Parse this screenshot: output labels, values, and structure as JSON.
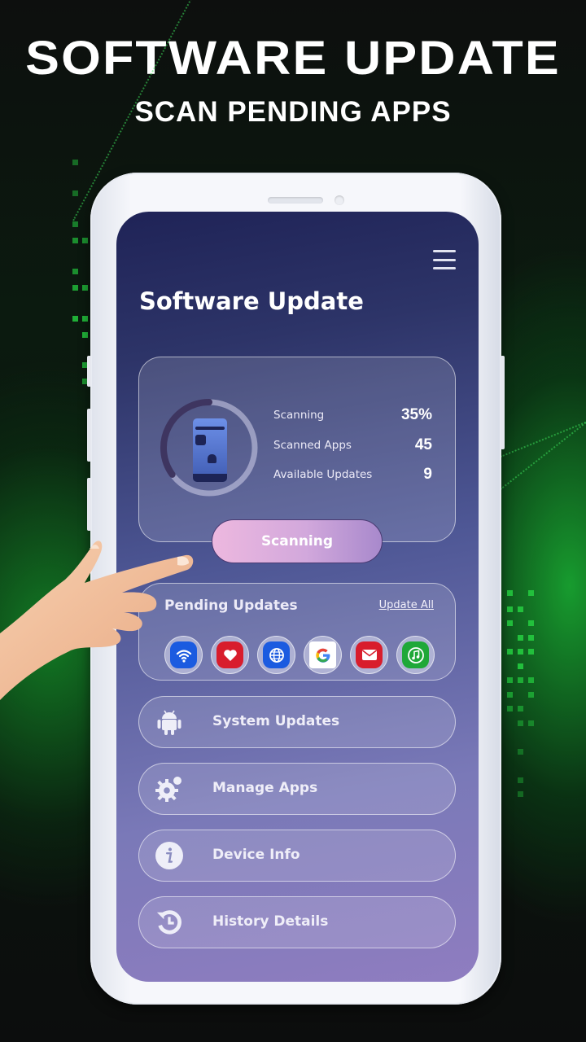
{
  "promo": {
    "title": "SOFTWARE UPDATE",
    "subtitle": "SCAN PENDING APPS"
  },
  "app": {
    "title": "Software Update",
    "menu_icon": "hamburger-menu-icon"
  },
  "scan_card": {
    "progress_percent": 35,
    "illustration": "phone-scan-illustration",
    "stats": [
      {
        "label": "Scanning",
        "value": "35%"
      },
      {
        "label": "Scanned Apps",
        "value": "45"
      },
      {
        "label": "Available Updates",
        "value": "9"
      }
    ],
    "button_label": "Scanning"
  },
  "pending": {
    "title": "Pending Updates",
    "update_all_label": "Update All",
    "apps": [
      {
        "name": "wifi-app",
        "icon": "wifi-icon",
        "color": "#1b5be0"
      },
      {
        "name": "health-app",
        "icon": "heart-icon",
        "color": "#d81d2c"
      },
      {
        "name": "browser-app",
        "icon": "globe-icon",
        "color": "#1b5be0"
      },
      {
        "name": "google-app",
        "icon": "google-icon",
        "color": "#ffffff"
      },
      {
        "name": "mail-app",
        "icon": "mail-icon",
        "color": "#d81d2c"
      },
      {
        "name": "music-app",
        "icon": "music-icon",
        "color": "#1fa838"
      }
    ]
  },
  "menu": [
    {
      "label": "System Updates",
      "icon": "android-icon"
    },
    {
      "label": "Manage Apps",
      "icon": "gear-icon"
    },
    {
      "label": "Device Info",
      "icon": "info-icon"
    },
    {
      "label": "History Details",
      "icon": "history-icon"
    }
  ]
}
